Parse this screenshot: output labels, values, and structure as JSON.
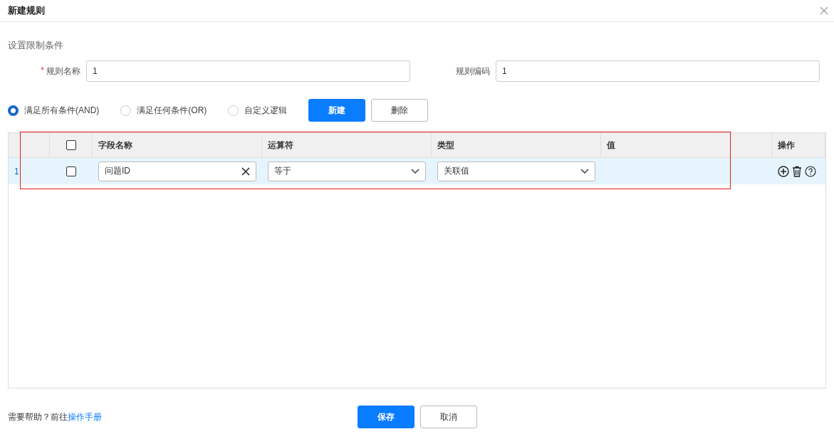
{
  "window": {
    "title": "新建规则"
  },
  "section_title": "设置限制条件",
  "fields": [
    {
      "required_mark": "*",
      "label": "规则名称",
      "value": "1"
    },
    {
      "label": "规则编码",
      "value": "1"
    }
  ],
  "logic_options": [
    {
      "label": "满足所有条件(AND)",
      "selected": true
    },
    {
      "label": "满足任何条件(OR)",
      "selected": false
    },
    {
      "label": "自定义逻辑",
      "selected": false
    }
  ],
  "toolbar_buttons": [
    {
      "label": "新建",
      "kind": "primary"
    },
    {
      "label": "删除",
      "kind": "default"
    }
  ],
  "table": {
    "select_all_checked": false,
    "columns": [
      "字段名称",
      "运算符",
      "类型",
      "值",
      "操作"
    ],
    "rows": [
      {
        "index": "1",
        "checked": false,
        "field": "问题ID",
        "operator": "等于",
        "type": "关联值"
      }
    ]
  },
  "footer": {
    "help_text": "需要帮助？前往",
    "help_link": "操作手册"
  },
  "footer_buttons": [
    {
      "label": "保存",
      "kind": "primary"
    },
    {
      "label": "取消",
      "kind": "default"
    }
  ]
}
